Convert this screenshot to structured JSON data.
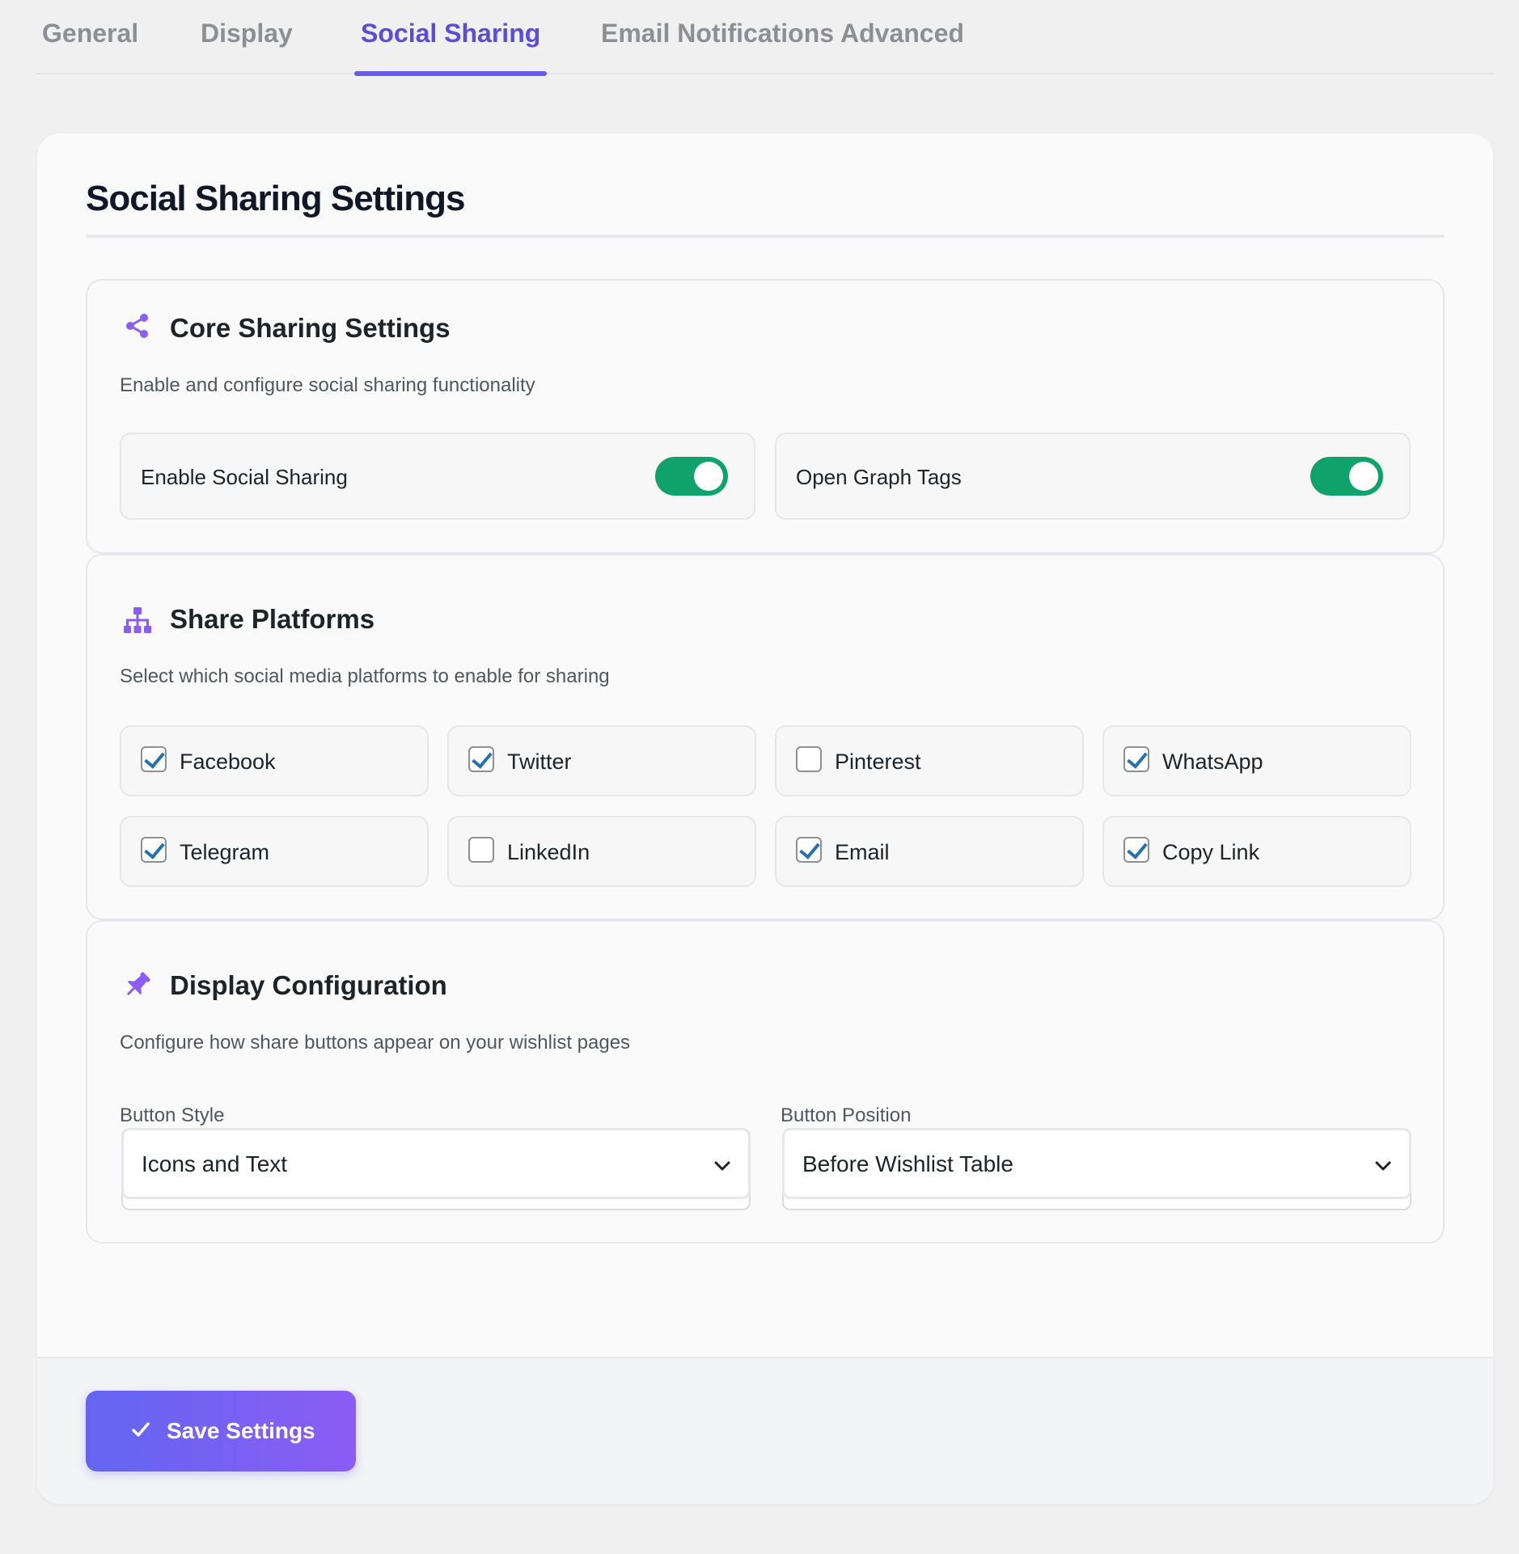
{
  "tabs": [
    {
      "label": "General"
    },
    {
      "label": "Display"
    },
    {
      "label": "Social Sharing"
    },
    {
      "label": "Email Notifications"
    },
    {
      "label": "Advanced"
    }
  ],
  "active_tab": "Social Sharing",
  "page": {
    "title": "Social Sharing Settings"
  },
  "core": {
    "icon": "share-icon",
    "title": "Core Sharing Settings",
    "description": "Enable and configure social sharing functionality",
    "toggles": [
      {
        "label": "Enable Social Sharing",
        "on": true
      },
      {
        "label": "Open Graph Tags",
        "on": true
      }
    ]
  },
  "platforms": {
    "icon": "sitemap-icon",
    "title": "Share Platforms",
    "description": "Select which social media platforms to enable for sharing",
    "items": [
      {
        "label": "Facebook",
        "checked": true
      },
      {
        "label": "Twitter",
        "checked": true
      },
      {
        "label": "Pinterest",
        "checked": false
      },
      {
        "label": "WhatsApp",
        "checked": true
      },
      {
        "label": "Telegram",
        "checked": true
      },
      {
        "label": "LinkedIn",
        "checked": false
      },
      {
        "label": "Email",
        "checked": true
      },
      {
        "label": "Copy Link",
        "checked": true
      }
    ]
  },
  "display": {
    "icon": "thumbtack-icon",
    "title": "Display Configuration",
    "description": "Configure how share buttons appear on your wishlist pages",
    "button_style": {
      "label": "Button Style",
      "value": "Icons and Text"
    },
    "button_position": {
      "label": "Button Position",
      "value": "Before Wishlist Table"
    }
  },
  "footer": {
    "save_label": "Save Settings"
  },
  "colors": {
    "accent": "#6b5ae6",
    "toggle_on": "#0fa36b",
    "icon": "#8b5cf6",
    "checkmark": "#2271b1"
  }
}
